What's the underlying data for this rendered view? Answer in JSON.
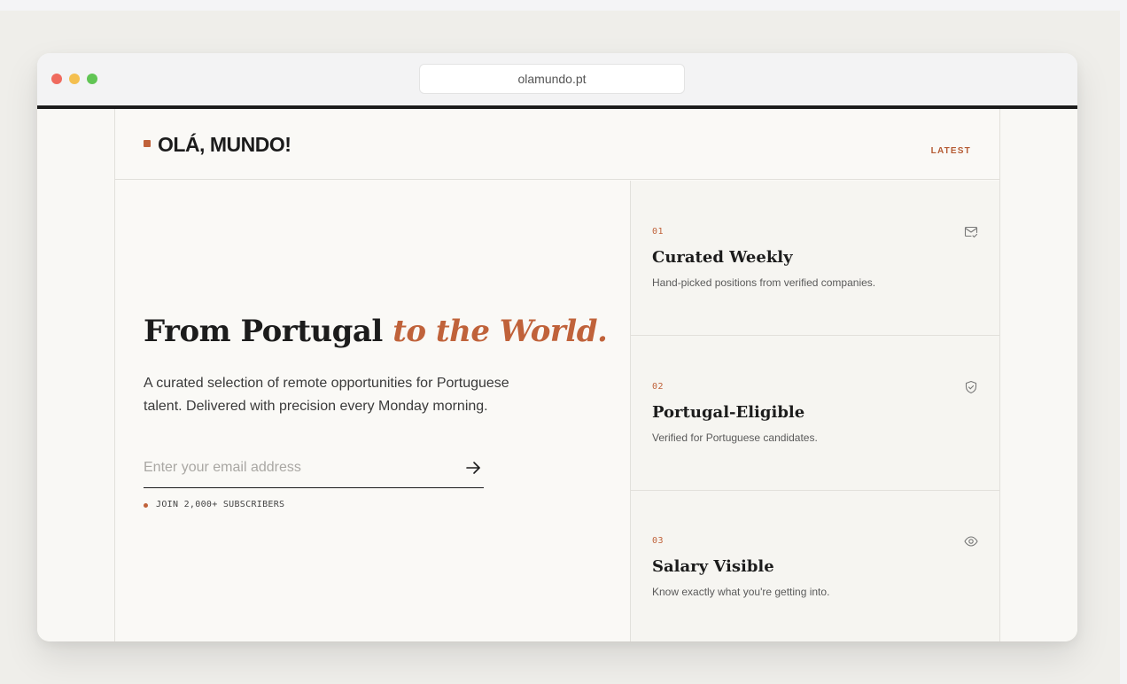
{
  "browser": {
    "url": "olamundo.pt"
  },
  "header": {
    "logo": "OLÁ, MUNDO!",
    "nav_latest": "LATEST"
  },
  "hero": {
    "title_main": "From Portugal",
    "title_accent": "to the World.",
    "description": "A curated selection of remote opportunities for Portuguese talent. Delivered with precision every Monday morning.",
    "email_placeholder": "Enter your email address",
    "email_value": "",
    "subscribers": "JOIN 2,000+ SUBSCRIBERS"
  },
  "features": [
    {
      "num": "01",
      "title": "Curated Weekly",
      "desc": "Hand-picked positions from verified companies.",
      "icon": "mail-check-icon"
    },
    {
      "num": "02",
      "title": "Portugal-Eligible",
      "desc": "Verified for Portuguese candidates.",
      "icon": "shield-check-icon"
    },
    {
      "num": "03",
      "title": "Salary Visible",
      "desc": "Know exactly what you're getting into.",
      "icon": "eye-icon"
    }
  ],
  "colors": {
    "accent": "#c0623a",
    "text": "#1c1c1c",
    "background": "#faf9f6"
  }
}
